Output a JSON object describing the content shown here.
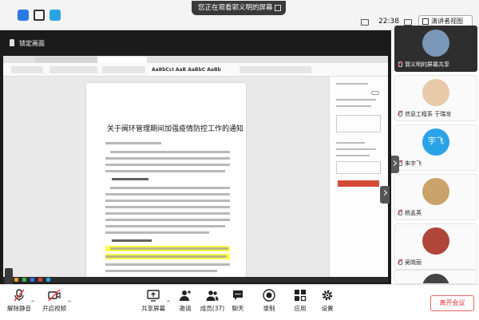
{
  "topbar": {
    "sharing_text": "您正在观看郭义明的屏幕",
    "clock": "22:38",
    "speaker_view_label": "演讲者视图"
  },
  "stage": {
    "lock_label": "锁定画面"
  },
  "shared_screen": {
    "style_preview": "AaBbCcI AaB AaBbC AaBb",
    "document_title": "关于闽环管理期间加强疫情防控工作的通知"
  },
  "participants": [
    {
      "name": "郭义明的屏幕共享",
      "avatar": "photo",
      "muted": true
    },
    {
      "name": "信息工程系 于瑞龙",
      "avatar": "photo",
      "muted": true
    },
    {
      "name": "朱宇飞",
      "avatar": "宇飞",
      "muted": true
    },
    {
      "name": "杨孟英",
      "avatar": "photo",
      "muted": true
    },
    {
      "name": "吴晓丽",
      "avatar": "photo",
      "muted": true
    },
    {
      "name": "",
      "avatar": "photo",
      "muted": false
    }
  ],
  "toolbar": {
    "unmute_label": "解除静音",
    "video_label": "开启视频",
    "share_label": "共享屏幕",
    "invite_label": "邀请",
    "members_label": "成员(37)",
    "chat_label": "聊天",
    "record_label": "录制",
    "apps_label": "应用",
    "settings_label": "设置",
    "leave_label": "离开会议"
  },
  "colors": {
    "leave": "#e33333",
    "highlight": "#ffff4a",
    "accent_blue": "#2aa3e6"
  }
}
